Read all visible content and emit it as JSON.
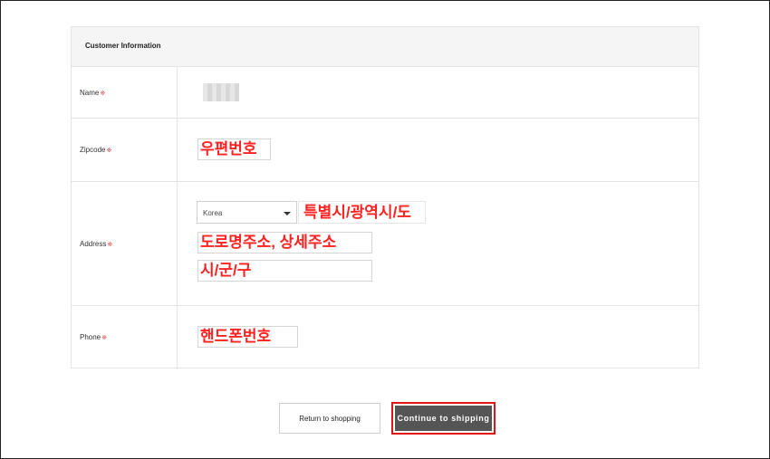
{
  "section": {
    "title": "Customer Information"
  },
  "required_mark": "※",
  "fields": {
    "name": {
      "label": "Name"
    },
    "zipcode": {
      "label": "Zipcode",
      "annotation": "우편번호"
    },
    "address": {
      "label": "Address",
      "country_value": "Korea",
      "annotation_region": "특별시/광역시/도",
      "annotation_street": "도로명주소, 상세주소",
      "annotation_city": "시/군/구"
    },
    "phone": {
      "label": "Phone",
      "annotation": "핸드폰번호"
    }
  },
  "buttons": {
    "return_label": "Return to shopping",
    "continue_label": "Continue to shipping"
  },
  "colors": {
    "annotation": "#ff2222",
    "highlight_border": "#e01616",
    "continue_bg": "#555555",
    "required": "#e03030"
  }
}
